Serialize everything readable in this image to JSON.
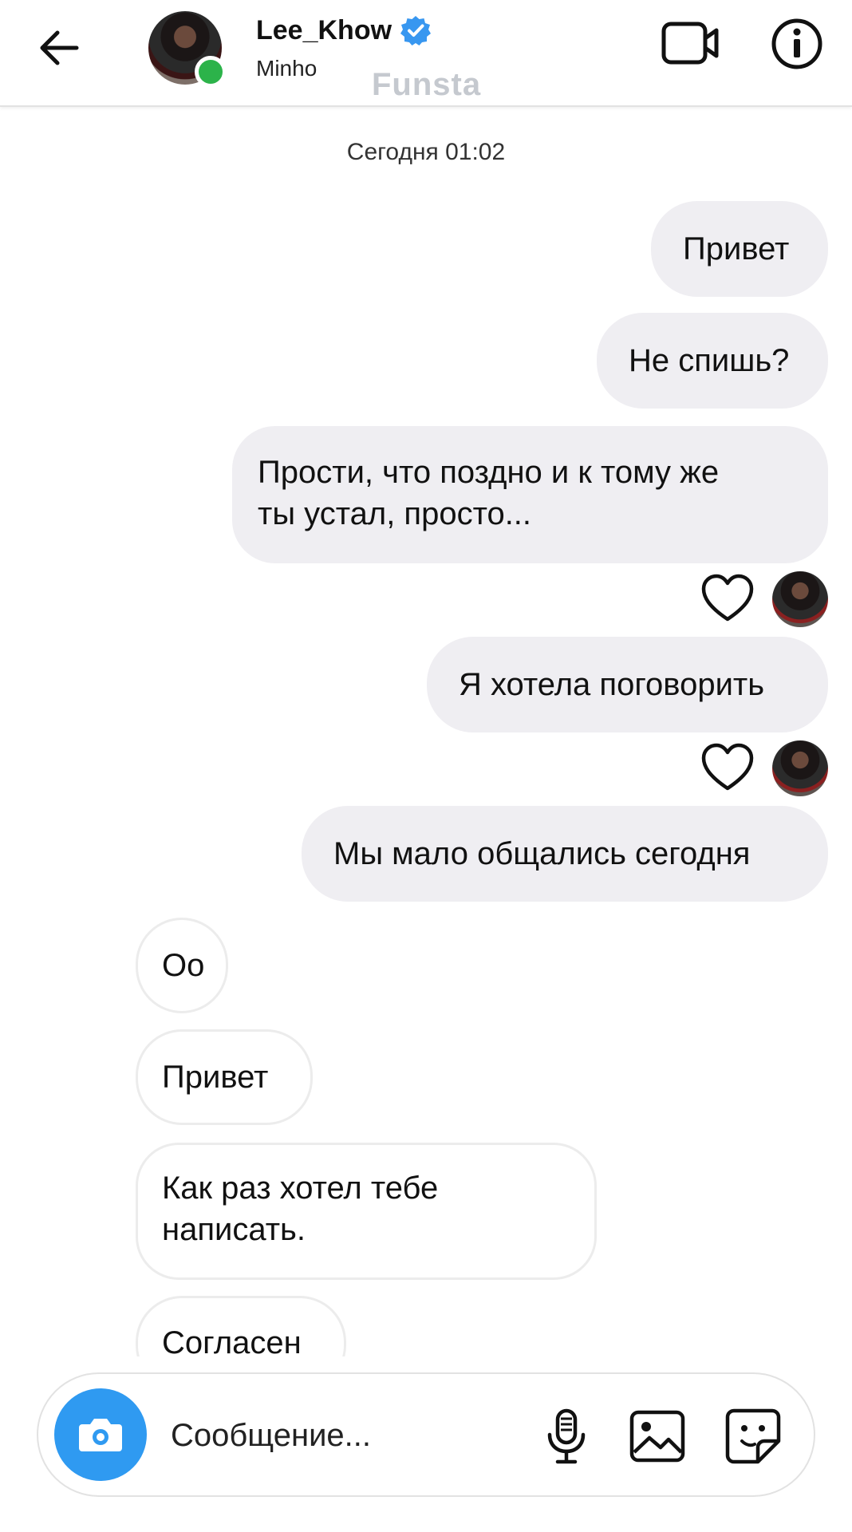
{
  "header": {
    "username": "Lee_Khow",
    "subname": "Minho",
    "watermark": "Funsta",
    "icons": [
      "back-arrow-icon",
      "verified-badge-icon",
      "video-call-icon",
      "info-icon"
    ]
  },
  "chat": {
    "timestamp": "Сегодня 01:02",
    "messages": [
      {
        "direction": "outgoing",
        "text": "Привет"
      },
      {
        "direction": "outgoing",
        "text": "Не спишь?"
      },
      {
        "direction": "outgoing",
        "lines": [
          "Прости, что поздно и к тому же",
          "ты устал, просто..."
        ],
        "reaction": "heart"
      },
      {
        "direction": "outgoing",
        "text": "Я хотела поговорить",
        "reaction": "heart"
      },
      {
        "direction": "outgoing",
        "text": "Мы мало общались сегодня"
      },
      {
        "direction": "incoming",
        "text": "Оо"
      },
      {
        "direction": "incoming",
        "text": "Привет"
      },
      {
        "direction": "incoming",
        "lines": [
          "Как раз хотел тебе",
          "написать."
        ]
      },
      {
        "direction": "incoming",
        "text": "Согласен"
      }
    ]
  },
  "composer": {
    "placeholder": "Сообщение...",
    "icons": [
      "camera-icon",
      "microphone-icon",
      "gallery-icon",
      "sticker-icon"
    ]
  },
  "colors": {
    "accent": "#2f9af1",
    "online": "#2cb34a",
    "verified": "#3897f0",
    "outgoing_bubble": "#efeef2",
    "watermark": "#c5c9cf"
  }
}
